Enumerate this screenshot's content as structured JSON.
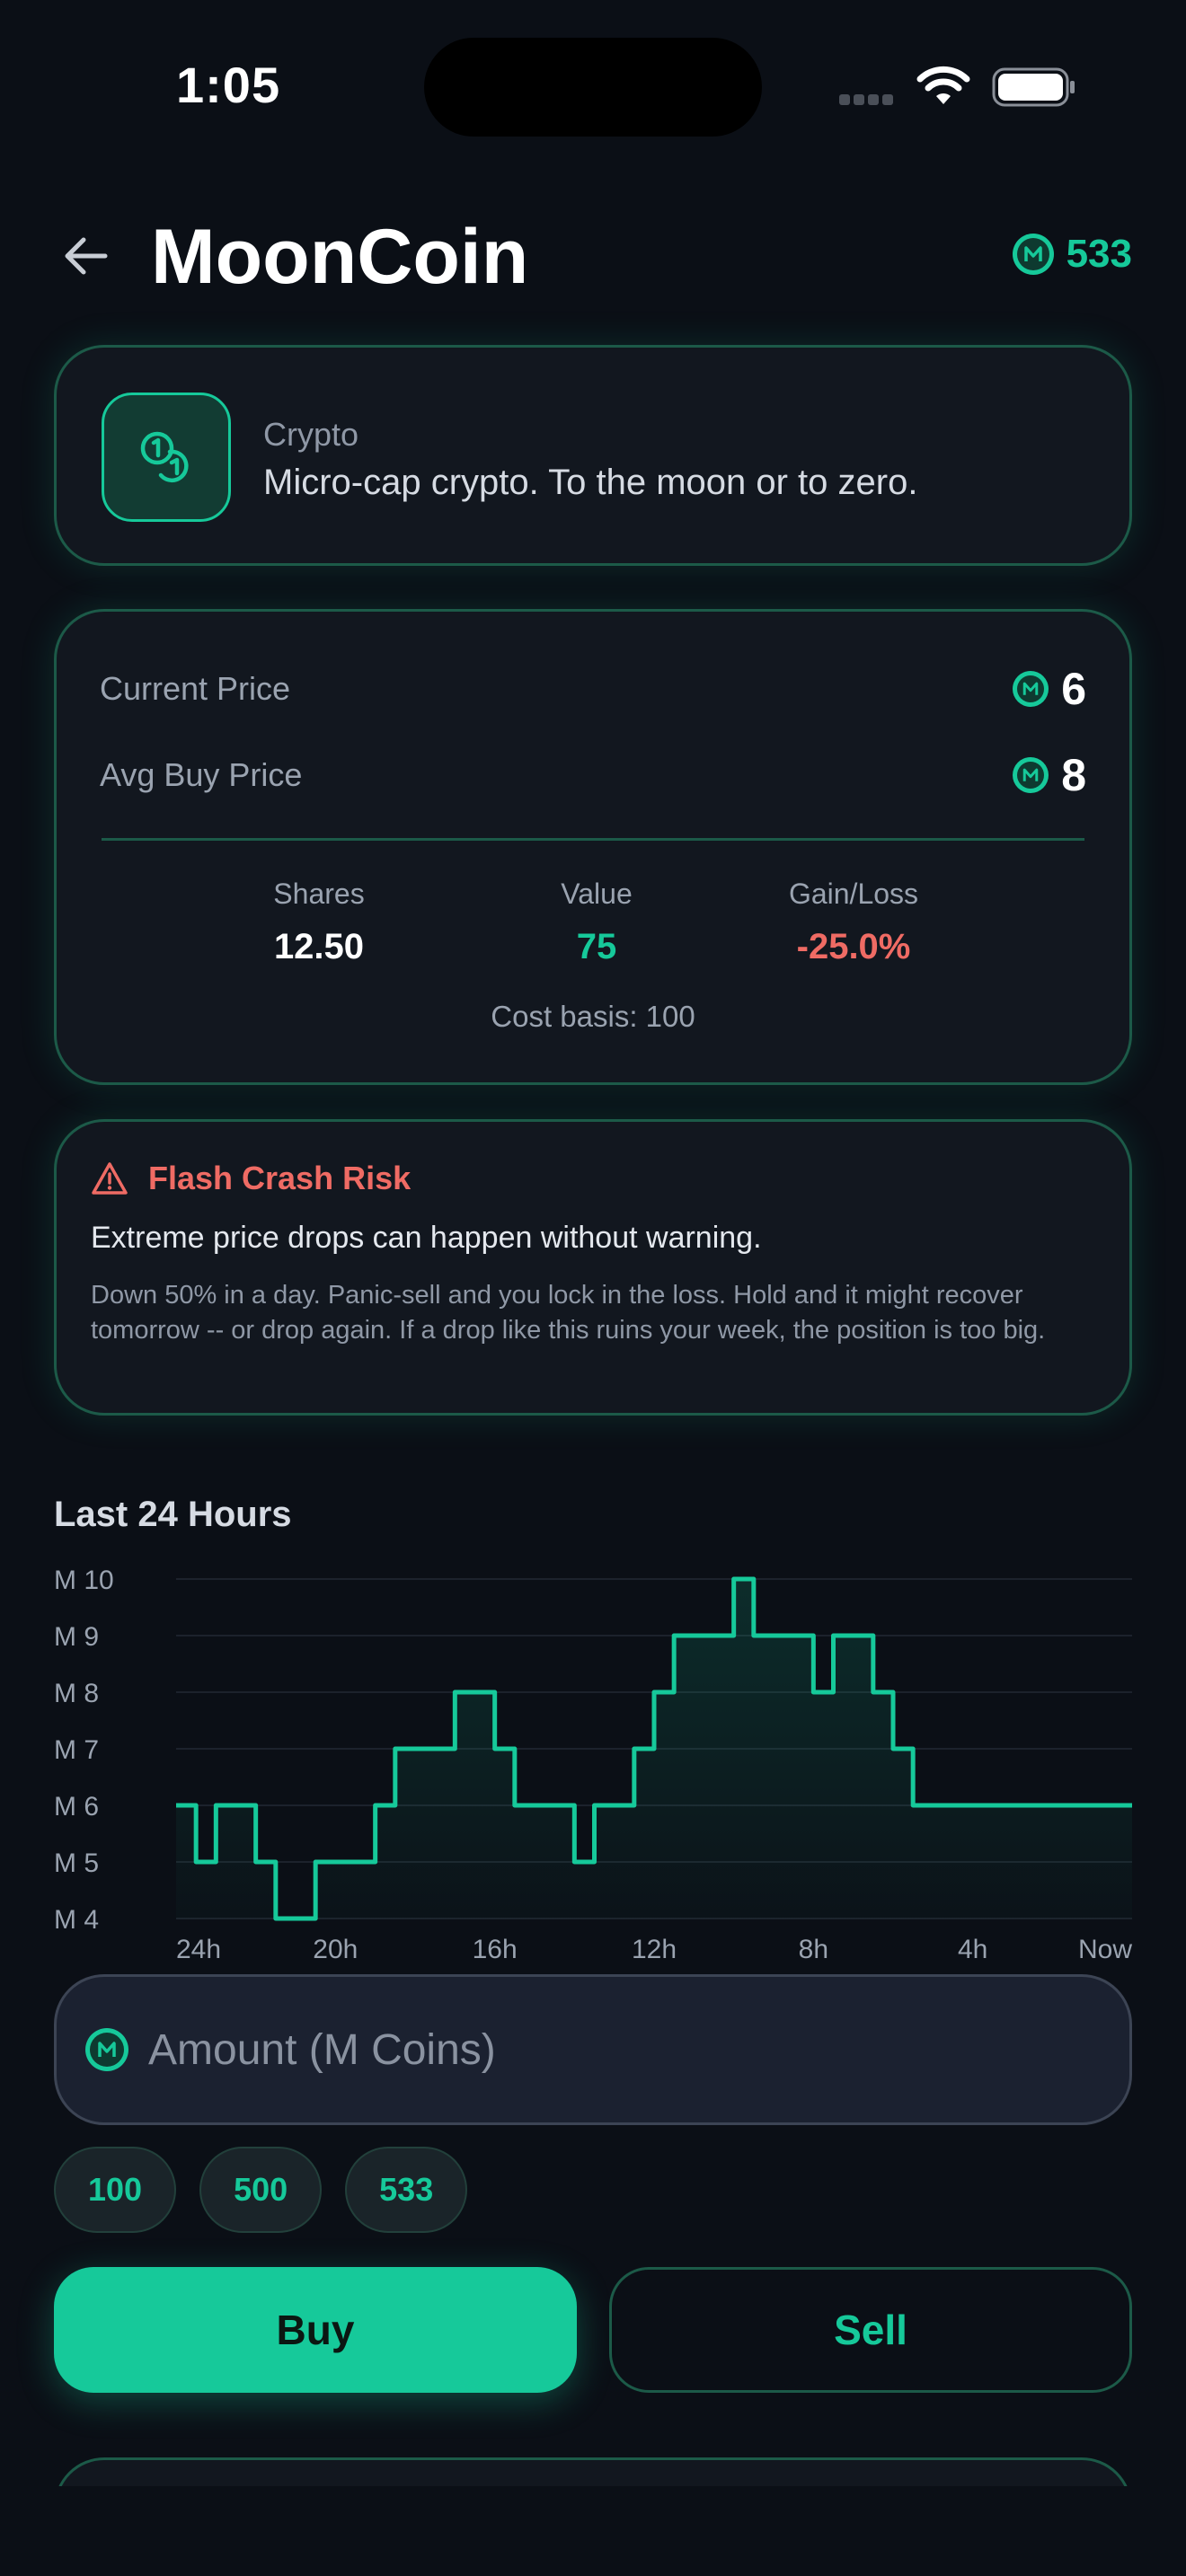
{
  "status_bar": {
    "time": "1:05"
  },
  "header": {
    "title": "MoonCoin",
    "balance": "533"
  },
  "category": {
    "label": "Crypto",
    "description": "Micro-cap crypto. To the moon or to zero."
  },
  "price": {
    "current_label": "Current Price",
    "current_value": "6",
    "avg_label": "Avg Buy Price",
    "avg_value": "8",
    "shares_label": "Shares",
    "shares_value": "12.50",
    "value_label": "Value",
    "value_value": "75",
    "gain_label": "Gain/Loss",
    "gain_value": "-25.0%",
    "cost_basis": "Cost basis: 100"
  },
  "warning": {
    "title": "Flash Crash Risk",
    "lead": "Extreme price drops can happen without warning.",
    "body": "Down 50% in a day. Panic-sell and you lock in the loss. Hold and it might recover tomorrow -- or drop again. If a drop like this ruins your week, the position is too big."
  },
  "chart_title": "Last 24 Hours",
  "chart_data": {
    "type": "line",
    "title": "Last 24 Hours",
    "y_tick_labels": [
      "M 10",
      "M 9",
      "M 8",
      "M 7",
      "M 6",
      "M 5",
      "M 4"
    ],
    "y_ticks": [
      10,
      9,
      8,
      7,
      6,
      5,
      4
    ],
    "ylim": [
      4,
      10
    ],
    "x_tick_labels": [
      "24h",
      "20h",
      "16h",
      "12h",
      "8h",
      "4h",
      "Now"
    ],
    "x_ticks": [
      24,
      20,
      16,
      12,
      8,
      4,
      0
    ],
    "xlim": [
      24,
      0
    ],
    "series": [
      {
        "x": [
          24,
          23.5,
          23,
          22.5,
          22,
          21.5,
          21,
          20.5,
          20,
          19.5,
          19,
          18.5,
          18,
          17.5,
          17,
          16.5,
          16,
          15.5,
          15,
          14.5,
          14,
          13.5,
          13,
          12.5,
          12,
          11.5,
          11,
          10.5,
          10,
          9.5,
          9,
          8.5,
          8,
          7.5,
          7,
          6.5,
          6,
          5.5,
          5,
          4.5,
          4,
          3.5,
          3,
          2.5,
          2,
          1.5,
          1,
          0.5,
          0
        ],
        "values": [
          6,
          5,
          6,
          6,
          5,
          4,
          4,
          5,
          5,
          5,
          6,
          7,
          7,
          7,
          8,
          8,
          7,
          6,
          6,
          6,
          5,
          6,
          6,
          7,
          8,
          9,
          9,
          9,
          10,
          9,
          9,
          9,
          8,
          9,
          9,
          8,
          7,
          6,
          6,
          6,
          6,
          6,
          6,
          6,
          6,
          6,
          6,
          6,
          6
        ]
      }
    ],
    "color": "#16c99a",
    "grid": true
  },
  "amount": {
    "placeholder": "Amount (M Coins)"
  },
  "chips": [
    "100",
    "500",
    "533"
  ],
  "actions": {
    "buy": "Buy",
    "sell": "Sell"
  },
  "colors": {
    "accent": "#16c99a",
    "loss": "#ef6b64",
    "background": "#0b0f16"
  },
  "icons": {
    "back": "arrow-left-icon",
    "coin": "m-coin-icon",
    "category": "coins-icon",
    "warning": "warning-triangle-icon"
  }
}
